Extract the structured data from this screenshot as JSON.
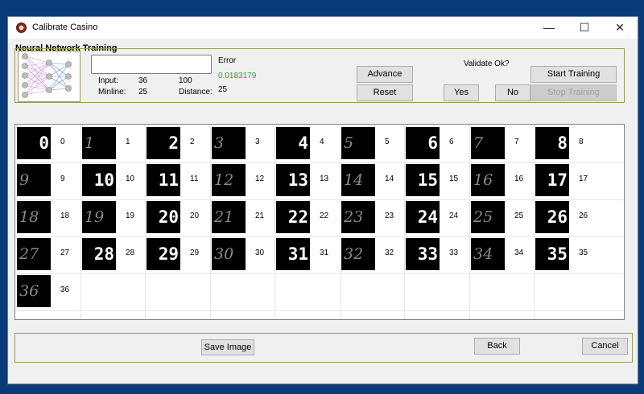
{
  "window": {
    "title": "Calibrate Casino",
    "minimize": "—",
    "maximize": "☐",
    "close": "✕"
  },
  "section_title": "Neural Network Training",
  "training": {
    "error_label": "Error",
    "error_value": "0.0183179",
    "error_input_value": "",
    "input_label": "Input:",
    "input_value": "36",
    "input_max": "100",
    "minline_label": "Minline:",
    "minline_value": "25",
    "distance_label": "Distance:",
    "distance_value": "25",
    "advance_label": "Advance",
    "reset_label": "Reset",
    "validate_label": "Validate Ok?",
    "yes_label": "Yes",
    "no_label": "No",
    "start_label": "Start Training",
    "stop_label": "Stop Training"
  },
  "samples": [
    {
      "image": "0",
      "label": "0",
      "bold": true
    },
    {
      "image": "1",
      "label": "1",
      "bold": false
    },
    {
      "image": "2",
      "label": "2",
      "bold": true
    },
    {
      "image": "3",
      "label": "3",
      "bold": false
    },
    {
      "image": "4",
      "label": "4",
      "bold": true
    },
    {
      "image": "5",
      "label": "5",
      "bold": false
    },
    {
      "image": "6",
      "label": "6",
      "bold": true
    },
    {
      "image": "7",
      "label": "7",
      "bold": false
    },
    {
      "image": "8",
      "label": "8",
      "bold": true
    },
    {
      "image": "9",
      "label": "9",
      "bold": false
    },
    {
      "image": "10",
      "label": "10",
      "bold": true
    },
    {
      "image": "11",
      "label": "11",
      "bold": true
    },
    {
      "image": "12",
      "label": "12",
      "bold": false
    },
    {
      "image": "13",
      "label": "13",
      "bold": true
    },
    {
      "image": "14",
      "label": "14",
      "bold": false
    },
    {
      "image": "15",
      "label": "15",
      "bold": true
    },
    {
      "image": "16",
      "label": "16",
      "bold": false
    },
    {
      "image": "17",
      "label": "17",
      "bold": true
    },
    {
      "image": "18",
      "label": "18",
      "bold": false
    },
    {
      "image": "19",
      "label": "19",
      "bold": false
    },
    {
      "image": "20",
      "label": "20",
      "bold": true
    },
    {
      "image": "21",
      "label": "21",
      "bold": false
    },
    {
      "image": "22",
      "label": "22",
      "bold": true
    },
    {
      "image": "23",
      "label": "23",
      "bold": false
    },
    {
      "image": "24",
      "label": "24",
      "bold": true
    },
    {
      "image": "25",
      "label": "25",
      "bold": false
    },
    {
      "image": "26",
      "label": "26",
      "bold": true
    },
    {
      "image": "27",
      "label": "27",
      "bold": false
    },
    {
      "image": "28",
      "label": "28",
      "bold": true
    },
    {
      "image": "29",
      "label": "29",
      "bold": true
    },
    {
      "image": "30",
      "label": "30",
      "bold": false
    },
    {
      "image": "31",
      "label": "31",
      "bold": true
    },
    {
      "image": "32",
      "label": "32",
      "bold": false
    },
    {
      "image": "33",
      "label": "33",
      "bold": true
    },
    {
      "image": "34",
      "label": "34",
      "bold": false
    },
    {
      "image": "35",
      "label": "35",
      "bold": true
    },
    {
      "image": "36",
      "label": "36",
      "bold": false
    }
  ],
  "footer": {
    "save_image_label": "Save Image",
    "back_label": "Back",
    "cancel_label": "Cancel"
  }
}
